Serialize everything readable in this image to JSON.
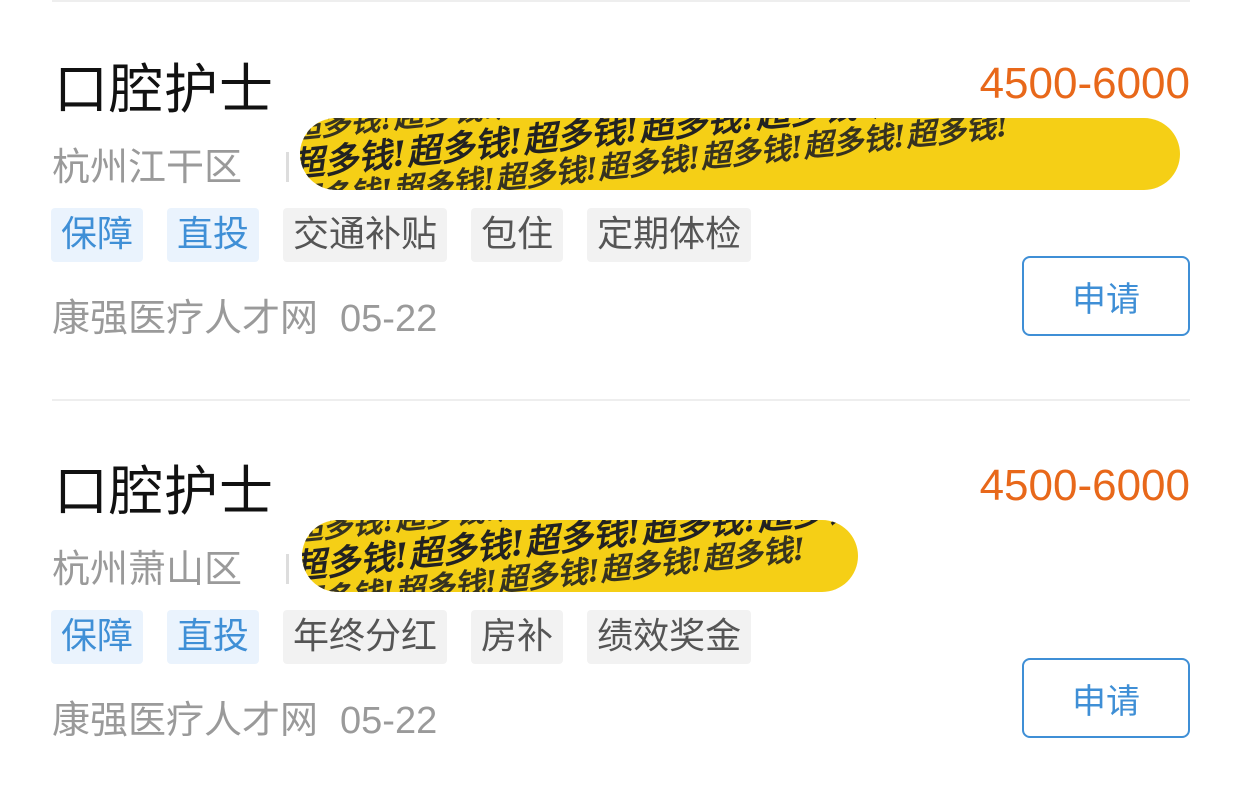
{
  "jobs": [
    {
      "title": "口腔护士",
      "salary": "4500-6000",
      "location": "杭州江干区",
      "scribble_text": "超多钱!超多钱!超多钱!超多钱!超多钱!超多钱!超多钱!",
      "tags": [
        {
          "label": "保障",
          "style": "blue"
        },
        {
          "label": "直投",
          "style": "blue"
        },
        {
          "label": "交通补贴",
          "style": "gray"
        },
        {
          "label": "包住",
          "style": "gray"
        },
        {
          "label": "定期体检",
          "style": "gray"
        }
      ],
      "source": "康强医疗人才网",
      "date": "05-22",
      "apply_label": "申请"
    },
    {
      "title": "口腔护士",
      "salary": "4500-6000",
      "location": "杭州萧山区",
      "scribble_text": "超多钱!超多钱!超多钱!超多钱!超多钱!",
      "tags": [
        {
          "label": "保障",
          "style": "blue"
        },
        {
          "label": "直投",
          "style": "blue"
        },
        {
          "label": "年终分红",
          "style": "gray"
        },
        {
          "label": "房补",
          "style": "gray"
        },
        {
          "label": "绩效奖金",
          "style": "gray"
        }
      ],
      "source": "康强医疗人才网",
      "date": "05-22",
      "apply_label": "申请"
    }
  ],
  "colors": {
    "salary": "#e8681a",
    "accent_blue": "#3f8fd6",
    "scribble": "#f5cf16",
    "muted_text": "#9a9a9a"
  }
}
